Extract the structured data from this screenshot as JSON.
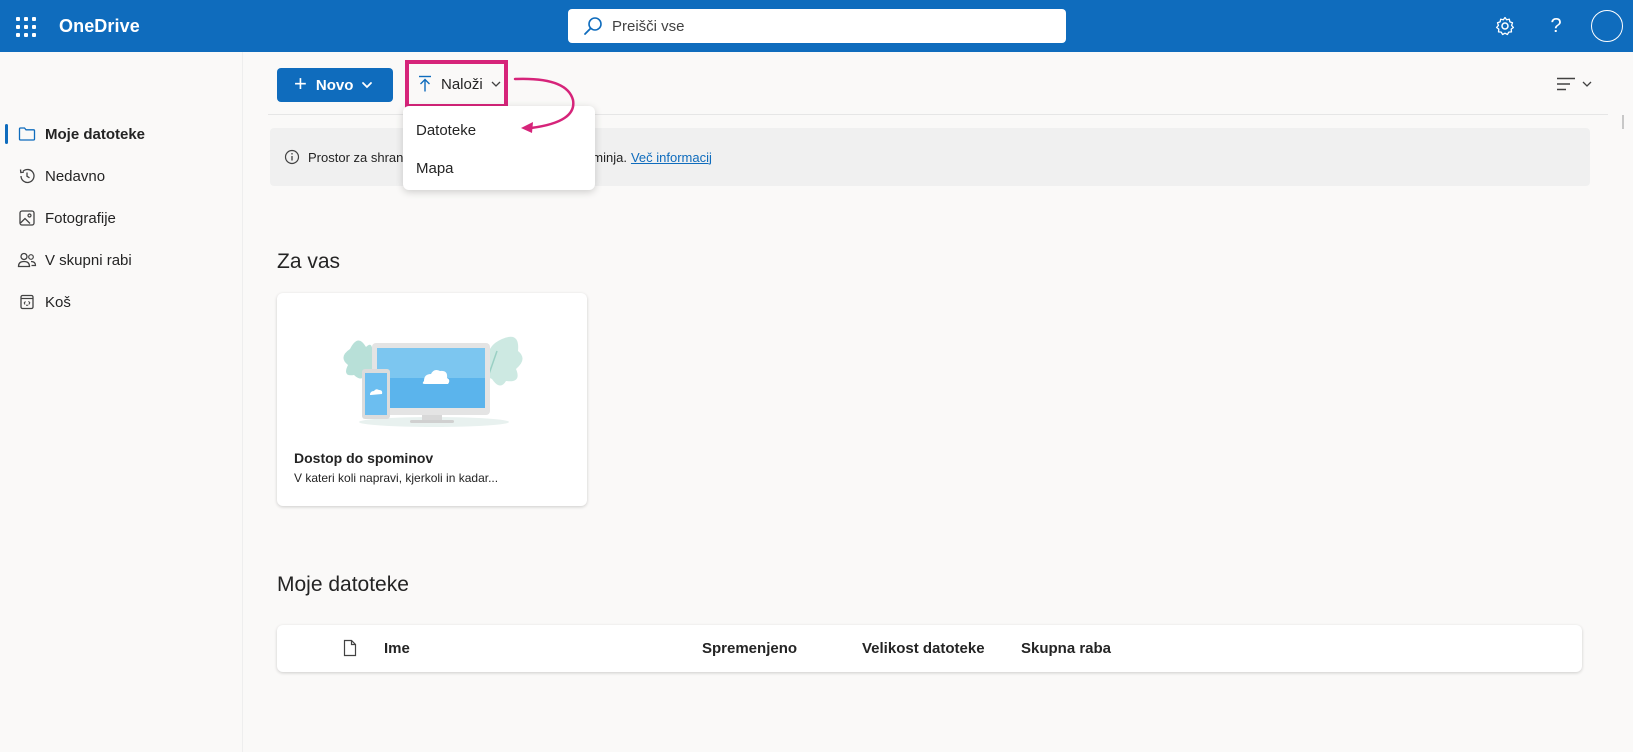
{
  "app": {
    "brand": "OneDrive"
  },
  "search": {
    "placeholder": "Preišči vse"
  },
  "header_icons": [
    "waffle-icon",
    "settings-icon",
    "help-icon",
    "avatar"
  ],
  "sidebar": {
    "items": [
      {
        "label": "Moje datoteke",
        "icon": "folder-icon",
        "active": true
      },
      {
        "label": "Nedavno",
        "icon": "history-icon",
        "active": false
      },
      {
        "label": "Fotografije",
        "icon": "image-icon",
        "active": false
      },
      {
        "label": "V skupni rabi",
        "icon": "people-icon",
        "active": false
      },
      {
        "label": "Koš",
        "icon": "recycle-bin-icon",
        "active": false
      }
    ]
  },
  "toolbar": {
    "new_label": "Novo",
    "upload_label": "Naloži"
  },
  "upload_menu": {
    "items": [
      "Datoteke",
      "Mapa"
    ]
  },
  "info_banner": {
    "text_start": "Prostor za shranj",
    "text_end": "minja.",
    "link": "Več informacij"
  },
  "for_you": {
    "heading": "Za vas",
    "card": {
      "title": "Dostop do spominov",
      "subtitle": "V kateri koli napravi, kjerkoli in kadar..."
    }
  },
  "my_files": {
    "heading": "Moje datoteke",
    "columns": [
      "Ime",
      "Spremenjeno",
      "Velikost datoteke",
      "Skupna raba"
    ]
  },
  "colors": {
    "brand": "#0f6cbd",
    "highlight": "#d6247a"
  }
}
